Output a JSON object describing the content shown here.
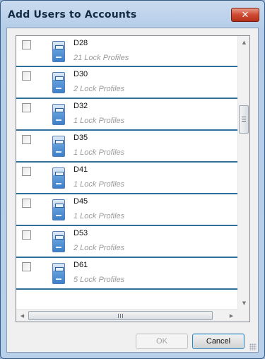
{
  "window": {
    "title": "Add Users to Accounts",
    "close_icon": "close-icon"
  },
  "list": {
    "items": [
      {
        "name": "D28",
        "profiles": "21 Lock Profiles",
        "checked": false
      },
      {
        "name": "D30",
        "profiles": "2 Lock Profiles",
        "checked": false
      },
      {
        "name": "D32",
        "profiles": "1 Lock Profiles",
        "checked": false
      },
      {
        "name": "D35",
        "profiles": "1 Lock Profiles",
        "checked": false
      },
      {
        "name": "D41",
        "profiles": "1 Lock Profiles",
        "checked": false
      },
      {
        "name": "D45",
        "profiles": "1 Lock Profiles",
        "checked": false
      },
      {
        "name": "D53",
        "profiles": "2 Lock Profiles",
        "checked": false
      },
      {
        "name": "D61",
        "profiles": "5 Lock Profiles",
        "checked": false
      }
    ]
  },
  "buttons": {
    "ok_label": "OK",
    "cancel_label": "Cancel"
  }
}
